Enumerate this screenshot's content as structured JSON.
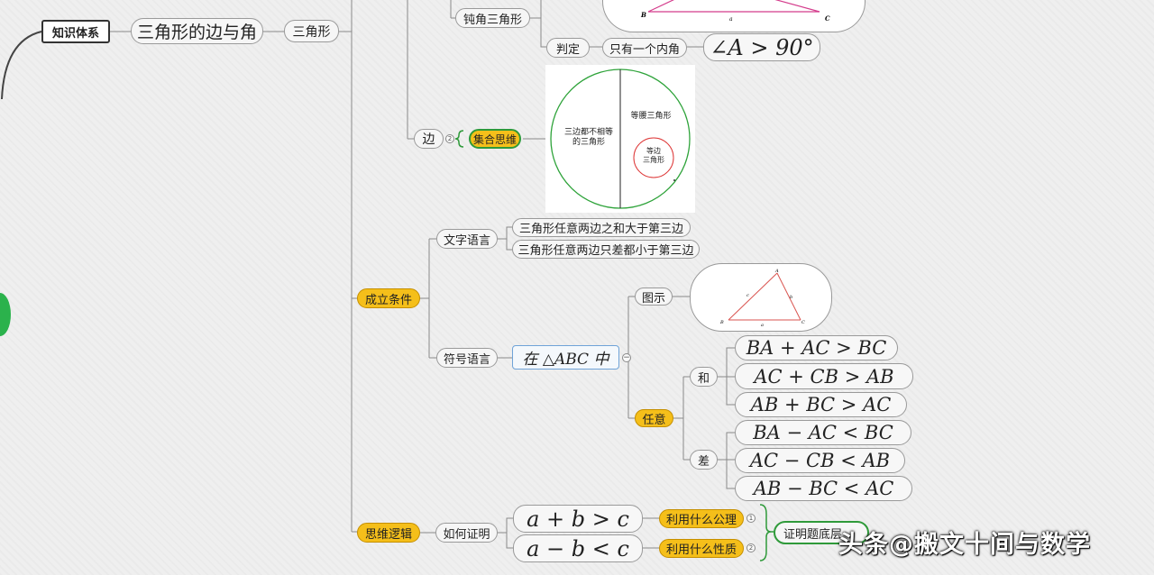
{
  "nodes": {
    "root": "知识体系",
    "topic": "三角形的边与角",
    "triangle": "三角形",
    "obtuse": "钝角三角形",
    "judge": "判定",
    "one_angle": "只有一个内角",
    "angle_formula": "∠A > 90°",
    "side": "边",
    "set_thinking": "集合思维",
    "conditions": "成立条件",
    "text_lang": "文字语言",
    "rule_sum": "三角形任意两边之和大于第三边",
    "rule_diff": "三角形任意两边只差都小于第三边",
    "symbol_lang": "符号语言",
    "in_triangle": "在 △ABC 中",
    "figure": "图示",
    "any": "任意",
    "sum": "和",
    "diff": "差",
    "ineq_sum_1": "BA + AC > BC",
    "ineq_sum_2": "AC + CB > AB",
    "ineq_sum_3": "AB + BC > AC",
    "ineq_diff_1": "BA − AC < BC",
    "ineq_diff_2": "AC − CB < AB",
    "ineq_diff_3": "AB − BC < AC",
    "thinking_logic": "思维逻辑",
    "how_prove": "如何证明",
    "ineq_ab_sum": "a + b > c",
    "ineq_ab_diff": "a − b < c",
    "use_axiom": "利用什么公理",
    "use_property": "利用什么性质",
    "proof_bottom": "证明题底层"
  },
  "badges": {
    "side": "2",
    "axiom": "1",
    "property": "2"
  },
  "venn": {
    "left": "三边都不相等\n的三角形",
    "right": "等腰三角形",
    "inner": "等边\n三角形"
  },
  "triangle_fig": {
    "A": "A",
    "B": "B",
    "C": "C",
    "a": "a",
    "b": "b",
    "c": "c"
  },
  "top_fig": {
    "B": "B",
    "a": "a",
    "C": "C"
  },
  "watermark": "头条@搬文十间与数学",
  "colors": {
    "accent_yellow": "#f5bf1a",
    "green": "#2f9a3a",
    "line": "#8a8a8a"
  }
}
